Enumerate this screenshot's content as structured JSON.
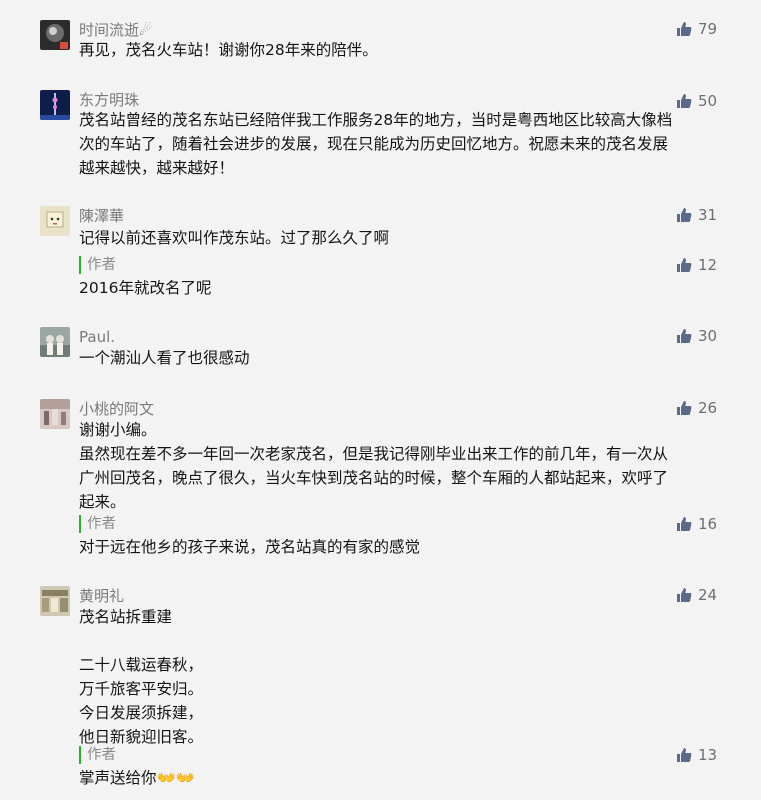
{
  "comments": [
    {
      "username": "时间流逝☄",
      "likes": "79",
      "text": "再见，茂名火车站！谢谢你28年来的陪伴。"
    },
    {
      "username": "东方明珠",
      "likes": "50",
      "text": "茂名站曾经的茂名东站已经陪伴我工作服务28年的地方，当时是粤西地区比较高大像档\n次的车站了，随着社会进步的发展，现在只能成为历史回忆地方。祝愿未来的茂名发展\n越来越快，越来越好！"
    },
    {
      "username": "陳澤華",
      "likes": "31",
      "text": "记得以前还喜欢叫作茂东站。过了那么久了啊",
      "reply": {
        "author_label": "作者",
        "likes": "12",
        "text": "2016年就改名了呢"
      }
    },
    {
      "username": "Paul.",
      "likes": "30",
      "text": "一个潮汕人看了也很感动"
    },
    {
      "username": "小桃的阿文",
      "likes": "26",
      "text": "谢谢小编。\n虽然现在差不多一年回一次老家茂名，但是我记得刚毕业出来工作的前几年，有一次从\n广州回茂名，晚点了很久，当火车快到茂名站的时候，整个车厢的人都站起来，欢呼了\n起来。",
      "reply": {
        "author_label": "作者",
        "likes": "16",
        "text": "对于远在他乡的孩子来说，茂名站真的有家的感觉"
      }
    },
    {
      "username": "黄明礼",
      "likes": "24",
      "text": "茂名站拆重建\n\n二十八载运春秋，\n万千旅客平安归。\n今日发展须拆建，\n他日新貌迎旧客。",
      "reply": {
        "author_label": "作者",
        "likes": "13",
        "text": "掌声送给你👐👐"
      }
    }
  ],
  "colors": {
    "like_icon": "#5a6a8a",
    "author_bar": "#28b428",
    "username": "#7a7a7a"
  },
  "icons": {
    "like": "thumbs-up-icon"
  }
}
